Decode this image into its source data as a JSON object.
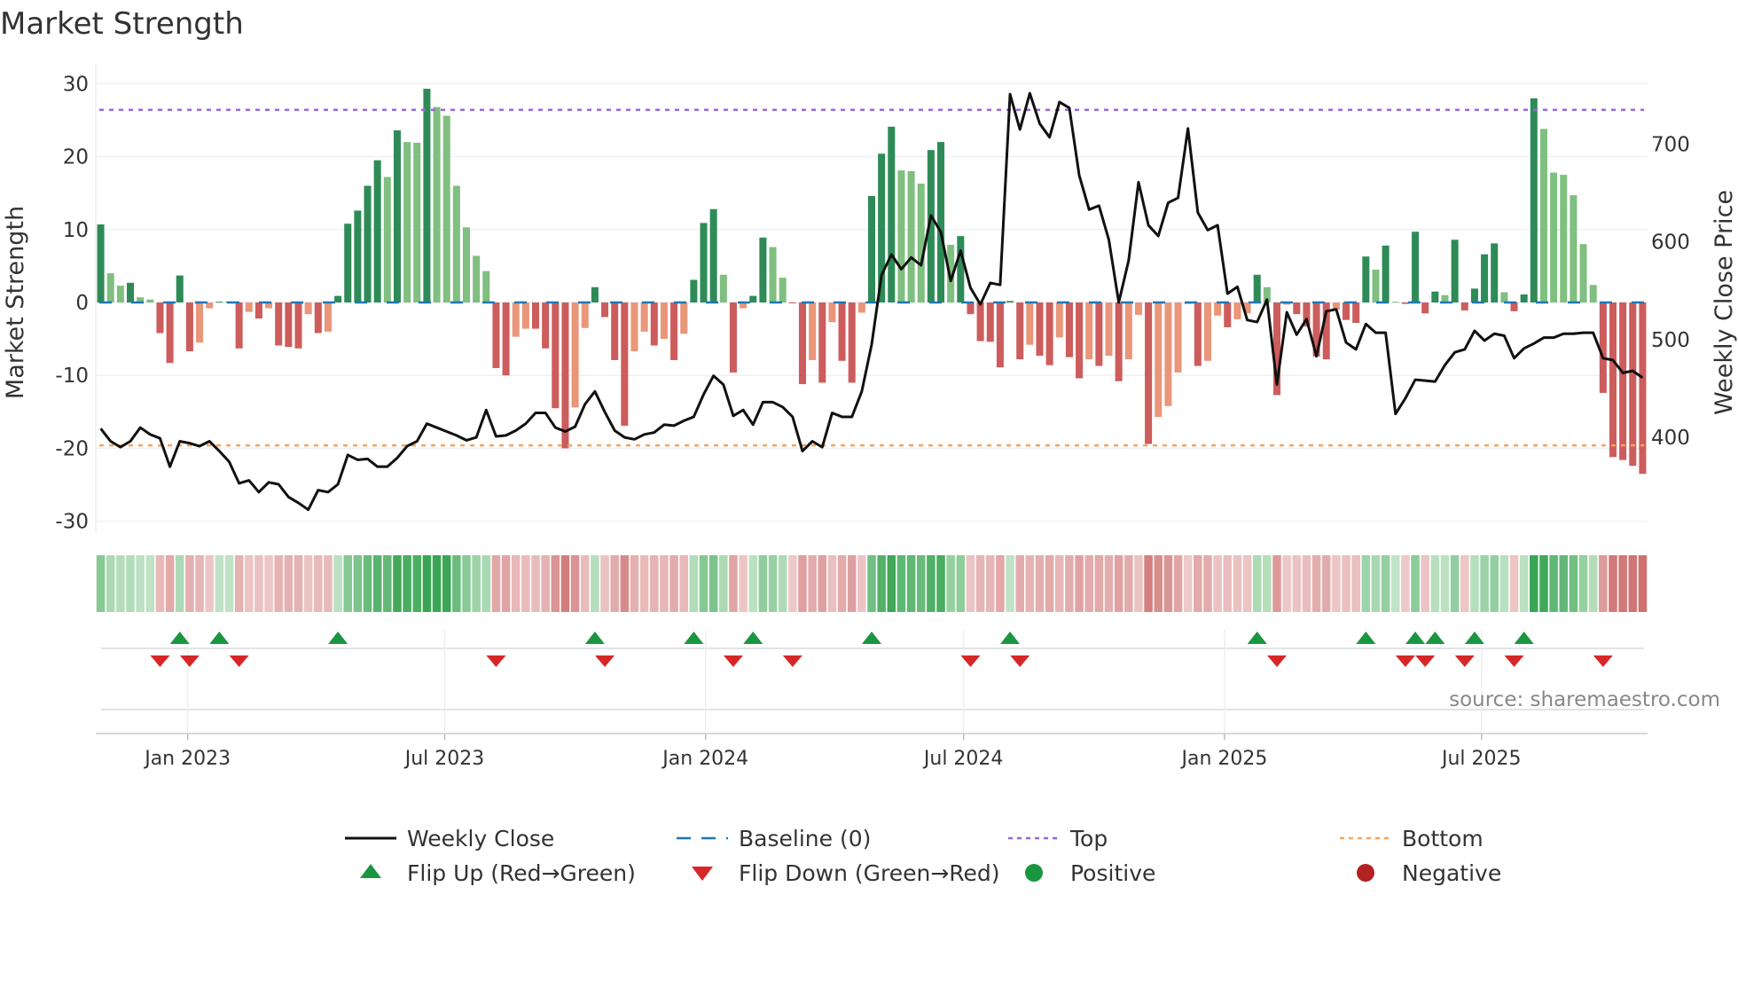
{
  "title": "Market Strength",
  "source": "source: sharemaestro.com",
  "colors": {
    "strong_up": "#2e8b57",
    "weak_up": "#7fbf7f",
    "strong_down": "#cd5c5c",
    "weak_down": "#e9967a",
    "baseline": "#1f77b4",
    "top": "#9966dd",
    "bottom": "#f4a460",
    "close": "#111111",
    "flip_up": "#1a9641",
    "flip_down": "#d62728",
    "positive": "#1a9641",
    "negative": "#b22222"
  },
  "chart_data": {
    "type": "bar+line",
    "title": "Market Strength",
    "ylabel": "Market Strength",
    "y2label": "Weekly Close Price",
    "ylim": [
      -31.5,
      31.5
    ],
    "y2lim": [
      303,
      773
    ],
    "yticks": [
      -30,
      -20,
      -10,
      0,
      10,
      20,
      30
    ],
    "y2ticks": [
      400,
      500,
      600,
      700
    ],
    "top_level": 26.4,
    "bottom_level": -19.6,
    "x_ticks": [
      {
        "label": "Jan 2023",
        "week": 8.8
      },
      {
        "label": "Jul 2023",
        "week": 34.8
      },
      {
        "label": "Jan 2024",
        "week": 61.2
      },
      {
        "label": "Jul 2024",
        "week": 87.3
      },
      {
        "label": "Jan 2025",
        "week": 113.7
      },
      {
        "label": "Jul 2025",
        "week": 139.7
      }
    ],
    "strength": [
      10.7,
      4,
      2.3,
      2.7,
      0.7,
      0.4,
      -4.2,
      -8.3,
      3.7,
      -6.7,
      -5.5,
      -0.8,
      0.1,
      0.1,
      -6.3,
      -1.3,
      -2.2,
      -0.8,
      -5.9,
      -6.1,
      -6.3,
      -1.6,
      -4.2,
      -4,
      0.9,
      10.8,
      12.6,
      16,
      19.5,
      17.2,
      23.6,
      22,
      21.9,
      29.3,
      26.8,
      25.6,
      16,
      10.3,
      6.4,
      4.3,
      -9,
      -10,
      -4.7,
      -3.6,
      -3.6,
      -6.3,
      -14.5,
      -20,
      -14.4,
      -3.5,
      2.1,
      -2,
      -7.9,
      -16.9,
      -6.7,
      -4,
      -5.9,
      -5,
      -7.9,
      -4.3,
      3.1,
      10.9,
      12.8,
      3.8,
      -9.6,
      -0.8,
      0.9,
      8.9,
      7.6,
      3.4,
      -0.1,
      -11.2,
      -7.9,
      -11,
      -2.7,
      -8,
      -11,
      -1.4,
      14.6,
      20.4,
      24.1,
      18.1,
      18,
      16.3,
      20.9,
      22,
      7.9,
      9.1,
      -1.6,
      -5.3,
      -5.4,
      -8.9,
      0.2,
      -7.8,
      -5.8,
      -7.3,
      -8.6,
      -4.8,
      -7.5,
      -10.4,
      -7.8,
      -8.7,
      -7.3,
      -10.8,
      -7.8,
      -1.7,
      -19.4,
      -15.7,
      -14.2,
      -9.6,
      -0.2,
      -8.7,
      -8,
      -1.8,
      -3.4,
      -2.3,
      -1.5,
      3.8,
      2.1,
      -12.7,
      -0.3,
      -1.6,
      -3.3,
      -7.4,
      -7.8,
      -1,
      -2.4,
      -2.8,
      6.3,
      4.5,
      7.8,
      0.1,
      -0.2,
      9.7,
      -1.5,
      1.5,
      1,
      8.6,
      -1.1,
      1.9,
      6.6,
      8.1,
      1.4,
      -1.2,
      1.1,
      28,
      23.8,
      17.8,
      17.5,
      14.7,
      8,
      2.4,
      -12.4,
      -21.2,
      -21.6,
      -22.4,
      -23.5
    ],
    "weekly_close": [
      409,
      396,
      390,
      396,
      410,
      403,
      399,
      370,
      396,
      394,
      391,
      396,
      386,
      375,
      353,
      356,
      344,
      354,
      352,
      339,
      333,
      326,
      346,
      344,
      352,
      382,
      377,
      378,
      370,
      370,
      379,
      391,
      396,
      414,
      410,
      406,
      402,
      397,
      400,
      428,
      401,
      402,
      407,
      414,
      425,
      425,
      410,
      406,
      411,
      434,
      447,
      426,
      407,
      400,
      398,
      403,
      405,
      413,
      412,
      417,
      421,
      444,
      463,
      454,
      422,
      428,
      413,
      436,
      436,
      431,
      421,
      386,
      396,
      390,
      425,
      421,
      421,
      447,
      495,
      566,
      587,
      572,
      584,
      576,
      627,
      610,
      560,
      591,
      553,
      536,
      558,
      556,
      751,
      715,
      752,
      721,
      707,
      743,
      737,
      668,
      633,
      637,
      602,
      538,
      581,
      661,
      617,
      606,
      640,
      645,
      716,
      630,
      612,
      617,
      547,
      554,
      520,
      518,
      541,
      454,
      528,
      505,
      521,
      483,
      529,
      531,
      497,
      490,
      516,
      507,
      507,
      424,
      440,
      459,
      458,
      457,
      474,
      487,
      490,
      509,
      499,
      506,
      504,
      481,
      491,
      496,
      502,
      502,
      506,
      506,
      507,
      507,
      481,
      479,
      466,
      468,
      461
    ]
  },
  "legend": [
    {
      "label": "Weekly Close",
      "kind": "line"
    },
    {
      "label": "Baseline (0)",
      "kind": "dash"
    },
    {
      "label": "Top",
      "kind": "dot-top"
    },
    {
      "label": "Bottom",
      "kind": "dot-bottom"
    },
    {
      "label": "Flip Up (Red→Green)",
      "kind": "tri-up"
    },
    {
      "label": "Flip Down (Green→Red)",
      "kind": "tri-down"
    },
    {
      "label": "Positive",
      "kind": "circle-pos"
    },
    {
      "label": "Negative",
      "kind": "circle-neg"
    }
  ]
}
